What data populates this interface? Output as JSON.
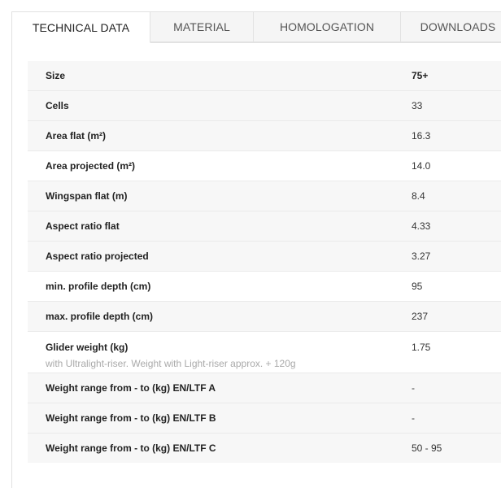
{
  "tabs": [
    {
      "label": "TECHNICAL DATA",
      "active": true
    },
    {
      "label": "MATERIAL",
      "active": false
    },
    {
      "label": "HOMOLOGATION",
      "active": false
    },
    {
      "label": "DOWNLOADS",
      "active": false
    }
  ],
  "rows": [
    {
      "label": "Size",
      "value": "75+"
    },
    {
      "label": "Cells",
      "value": "33"
    },
    {
      "label": "Area flat (m²)",
      "value": "16.3"
    },
    {
      "label": "Area projected (m²)",
      "value": "14.0"
    },
    {
      "label": "Wingspan flat (m)",
      "value": "8.4"
    },
    {
      "label": "Aspect ratio flat",
      "value": "4.33"
    },
    {
      "label": "Aspect ratio projected",
      "value": "3.27"
    },
    {
      "label": "min. profile depth (cm)",
      "value": "95"
    },
    {
      "label": "max. profile depth (cm)",
      "value": "237"
    },
    {
      "label": "Glider weight (kg)",
      "value": "1.75",
      "note": "with Ultralight-riser. Weight with Light-riser approx. + 120g"
    },
    {
      "label": "Weight range from - to (kg) EN/LTF A",
      "value": "-"
    },
    {
      "label": "Weight range from - to (kg) EN/LTF B",
      "value": "-"
    },
    {
      "label": "Weight range from - to (kg) EN/LTF C",
      "value": "50 - 95"
    }
  ]
}
